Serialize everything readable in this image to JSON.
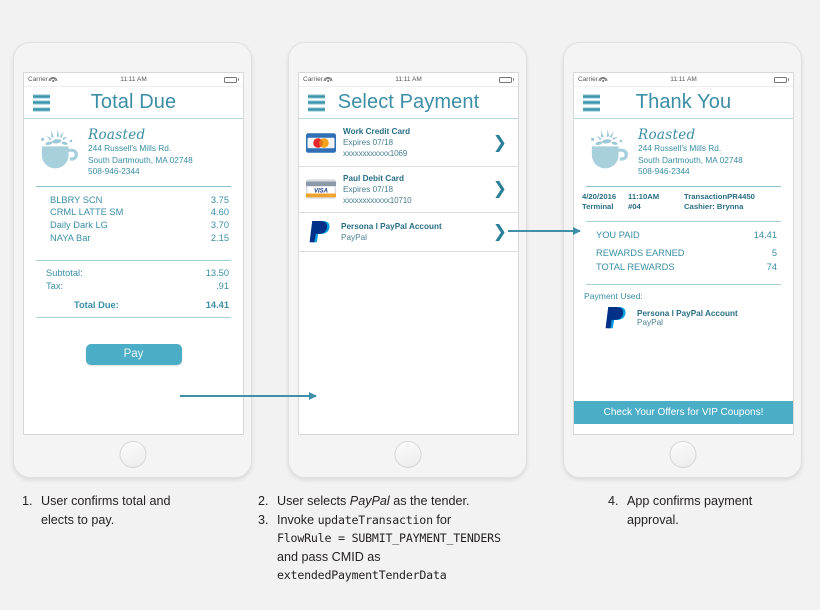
{
  "status_bar": {
    "carrier": "Carrier",
    "time": "11:11 AM",
    "wifi_icon": "wifi-icon",
    "battery_icon": "battery-icon"
  },
  "store": {
    "brand": "Roasted",
    "address1": "244 Russell's Mills Rd.",
    "address2": "South Dartmouth, MA 02748",
    "phone": "508-946-2344",
    "logo_icon": "coffee-cup-splash-icon"
  },
  "colors": {
    "accent": "#4cadc6",
    "text_blue": "#3b8ea5",
    "header_blue": "#2a6e85",
    "arrow": "#3f8fa8",
    "caption_text": "#231f20"
  },
  "phone1": {
    "title": "Total Due",
    "menu_icon": "hamburger-menu-icon",
    "items": [
      {
        "name": "BLBRY SCN",
        "amount": "3.75"
      },
      {
        "name": "CRML LATTE SM",
        "amount": "4.60"
      },
      {
        "name": "Daily Dark LG",
        "amount": "3.70"
      },
      {
        "name": "NAYA Bar",
        "amount": "2.15"
      }
    ],
    "subtotal_label": "Subtotal:",
    "subtotal": "13.50",
    "tax_label": "Tax:",
    "tax": ".91",
    "total_label": "Total Due:",
    "total": "14.41",
    "pay_button": "Pay"
  },
  "phone2": {
    "title": "Select Payment",
    "menu_icon": "hamburger-menu-icon",
    "tenders": [
      {
        "icon": "mastercard-icon",
        "name": "Work Credit Card",
        "expires": "Expires 07/18",
        "number": "xxxxxxxxxxxx1069",
        "chevron": "❯"
      },
      {
        "icon": "visa-icon",
        "name": "Paul Debit  Card",
        "expires": "Expires 07/18",
        "number": "xxxxxxxxxxxx10710",
        "chevron": "❯"
      },
      {
        "icon": "paypal-icon",
        "name": "Persona l PayPal Account",
        "expires": "PayPal",
        "number": "",
        "chevron": "❯"
      }
    ]
  },
  "phone3": {
    "title": "Thank You",
    "menu_icon": "hamburger-menu-icon",
    "txn": {
      "date": "4/20/2016",
      "time": "11:10AM",
      "transaction_label": "Transaction",
      "transaction_id": "PR4450",
      "terminal_label": "Terminal",
      "terminal_id": "#04",
      "cashier": "Cashier: Brynna"
    },
    "you_paid_label": "YOU PAID",
    "you_paid": "14.41",
    "rewards_earned_label": "REWARDS EARNED",
    "rewards_earned": "5",
    "total_rewards_label": "TOTAL  REWARDS",
    "total_rewards": "74",
    "payment_used_label": "Payment Used:",
    "payment_used_name": "Persona l PayPal Account",
    "payment_used_type": "PayPal",
    "payment_used_icon": "paypal-icon",
    "vip_banner": "Check Your Offers for VIP Coupons!"
  },
  "captions": {
    "c1": {
      "num": "1.",
      "line1": "User confirms total and",
      "line2": "elects to pay."
    },
    "c2": {
      "num": "2.",
      "pre": "User selects ",
      "em": "PayPal",
      "post": " as the tender."
    },
    "c3": {
      "num": "3.",
      "l1a": "Invoke ",
      "l1mono": "updateTransaction",
      "l1b": " for",
      "l2mono": "FlowRule = SUBMIT_PAYMENT_TENDERS",
      "l3": "and pass CMID as",
      "l4mono": "extendedPaymentTenderData"
    },
    "c4": {
      "num": "4.",
      "line1": "App confirms payment",
      "line2": "approval."
    }
  }
}
